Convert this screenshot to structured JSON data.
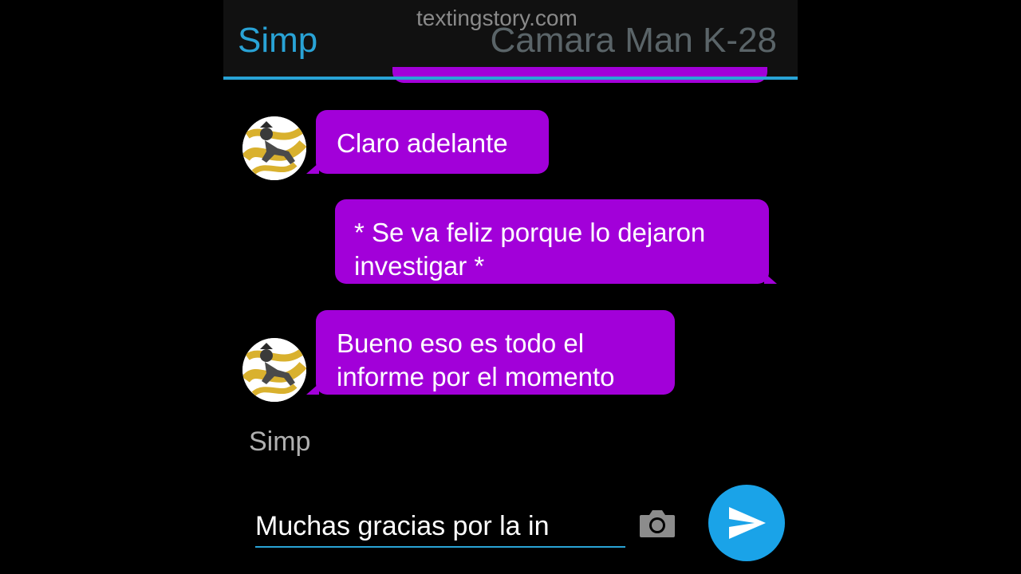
{
  "watermark": "textingstory.com",
  "header": {
    "contact_name": "Simp",
    "other_name": "Camara Man K-28"
  },
  "messages": [
    {
      "direction": "incoming",
      "text": "Claro adelante"
    },
    {
      "direction": "outgoing",
      "text": " * Se va feliz porque lo dejaron investigar *"
    },
    {
      "direction": "incoming",
      "text": "Bueno eso es todo el informe por el momento"
    }
  ],
  "typing_indicator": "Simp",
  "composer": {
    "text": "Muchas gracias por la in"
  },
  "icons": {
    "avatar": "avatar-image",
    "camera": "camera-icon",
    "send": "send-icon"
  },
  "colors": {
    "accent": "#29a3d6",
    "bubble": "#a200d9",
    "send_button": "#1aa3e8",
    "background": "#000000"
  }
}
